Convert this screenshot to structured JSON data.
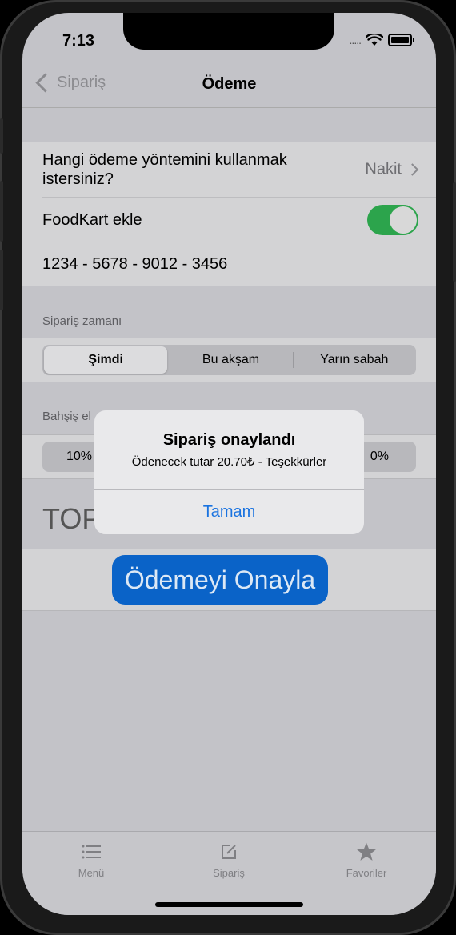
{
  "status": {
    "time": "7:13",
    "signal_dots": "....."
  },
  "nav": {
    "back_label": "Sipariş",
    "title": "Ödeme"
  },
  "payment": {
    "method_label": "Hangi ödeme yöntemini kullanmak istersiniz?",
    "method_value": "Nakit",
    "foodkart_label": "FoodKart ekle",
    "foodkart_on": true,
    "card_number": "1234 - 5678 - 9012 - 3456"
  },
  "order_time": {
    "header": "Sipariş zamanı",
    "options": [
      "Şimdi",
      "Bu akşam",
      "Yarın sabah"
    ],
    "selected": "Şimdi"
  },
  "tip": {
    "header_visible": "Bahşiş el",
    "left_option": "10%",
    "right_option": "0%"
  },
  "total_title_visible": "TOP",
  "confirm_button": "Ödemeyi Onayla",
  "alert": {
    "title": "Sipariş onaylandı",
    "message": "Ödenecek tutar 20.70₺ - Teşekkürler",
    "button": "Tamam"
  },
  "tabbar": {
    "items": [
      {
        "label": "Menü",
        "icon": "list-icon"
      },
      {
        "label": "Sipariş",
        "icon": "compose-icon"
      },
      {
        "label": "Favoriler",
        "icon": "star-icon"
      }
    ]
  },
  "colors": {
    "accent": "#1a73e0",
    "toggle_on": "#2ca44c",
    "confirm_button_bg": "#0a63c8"
  }
}
